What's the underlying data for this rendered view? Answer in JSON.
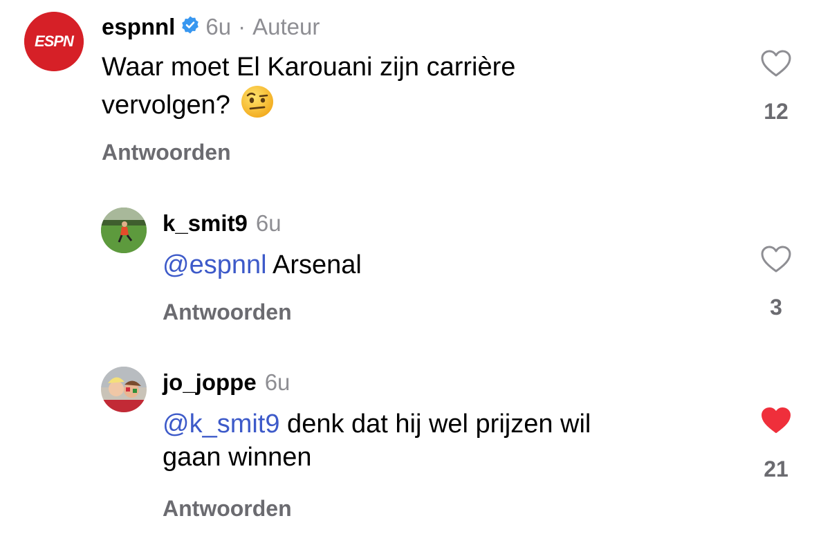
{
  "colors": {
    "text": "#000000",
    "secondary": "#8e8e93",
    "action": "#6b6b70",
    "mention": "#3d5ac9",
    "liked": "#ef2f3b",
    "verified": "#3897f0",
    "espn_red": "#d62027"
  },
  "comments": [
    {
      "username": "espnnl",
      "verified": true,
      "time": "6u",
      "separator": "·",
      "author_tag": "Auteur",
      "avatar_logo_text": "ESPN",
      "mention": "",
      "text_line1": "Waar moet El Karouani zijn carrière",
      "text_line2": "vervolgen?",
      "emoji": "raised-eyebrow-emoji",
      "reply_label": "Antwoorden",
      "like_count": "12",
      "liked": false
    },
    {
      "username": "k_smit9",
      "time": "6u",
      "mention": "@espnnl",
      "text": " Arsenal",
      "reply_label": "Antwoorden",
      "like_count": "3",
      "liked": false
    },
    {
      "username": "jo_joppe",
      "time": "6u",
      "mention": "@k_smit9",
      "text_line1": " denk dat hij wel prijzen wil",
      "text_line2": "gaan winnen",
      "reply_label": "Antwoorden",
      "like_count": "21",
      "liked": true
    }
  ]
}
